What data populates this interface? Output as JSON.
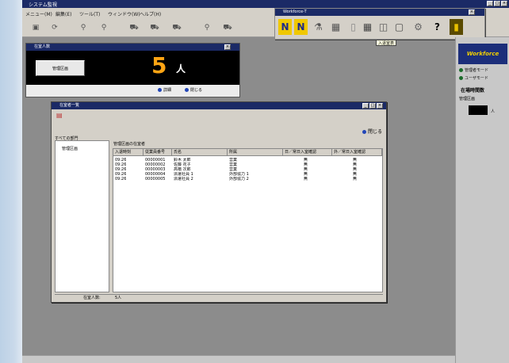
{
  "app": {
    "title": "システム監視",
    "menu": [
      "メニュー(M)",
      "編集(E)",
      "ツール(T)",
      "ウィンドウ(W)",
      "ヘルプ(H)"
    ],
    "toolbar_icons": [
      "save-icon",
      "refresh-icon",
      "bicycle-icon",
      "bicycle-icon",
      "car-icon",
      "truck-icon",
      "truck-icon",
      "car-icon",
      "truck-icon"
    ],
    "toolbar_glyphs": [
      "▣",
      "⟳",
      "⚲",
      "⚲",
      "⛟",
      "⛟",
      "⛟",
      "⚲",
      "⛟"
    ],
    "window_buttons": [
      "_",
      "□",
      "×"
    ]
  },
  "floating_toolbar": {
    "title": "Workforce-T",
    "icons": [
      "n-icon",
      "n-icon",
      "chart-icon",
      "grid-icon",
      "doc-icon",
      "grid-icon",
      "window-icon",
      "doc-icon",
      "gear-icon",
      "help-icon",
      "exit-icon"
    ],
    "glyphs": [
      "N",
      "N",
      "⚗",
      "▦",
      "▯",
      "▦",
      "◫",
      "▢",
      "⚙",
      "?",
      "▮"
    ],
    "tooltip": "入退室表"
  },
  "right_panel": {
    "logo": "Workforce",
    "modes": [
      "管理者モード",
      "ユーザモード"
    ],
    "section_title": "在場時間数",
    "section_label": "管理区画",
    "count_unit": "人"
  },
  "counter_window": {
    "title": "在室人数",
    "button_label": "管理区画",
    "count": "5",
    "unit": "人",
    "footer_btn1": "詳細",
    "footer_btn2": "閉じる",
    "accent": "#ffa514"
  },
  "dialog": {
    "title": "在室者一覧",
    "close_label": "閉じる",
    "tree_root": "すべての部門",
    "tree_child": "管理区画",
    "list_title": "管理区画の在室者",
    "columns": [
      "入退時刻",
      "従業員番号",
      "氏名",
      "所属",
      "日／常日",
      "入室確認",
      "外／常日",
      "入室確認"
    ],
    "col_labels": [
      "入退時刻",
      "従業員番号",
      "氏名",
      "所属",
      "日／常日入室確認",
      "外／常日入室確認"
    ],
    "rows": [
      [
        "09:26",
        "00000001",
        "鈴木 太郎",
        "営業",
        "無",
        "無"
      ],
      [
        "09:26",
        "00000002",
        "佐藤 花子",
        "営業",
        "無",
        "無"
      ],
      [
        "09:26",
        "00000003",
        "高橋 次郎",
        "営業",
        "無",
        "無"
      ],
      [
        "09:26",
        "00000004",
        "派遣社員 1",
        "外部協力 1",
        "無",
        "無"
      ],
      [
        "09:26",
        "00000005",
        "派遣社員 2",
        "外部協力 2",
        "無",
        "無"
      ]
    ],
    "status_label": "在室人数:",
    "status_value": "5人"
  },
  "colors": {
    "titlebar": "#1b2a66",
    "background": "#8c8c8c"
  }
}
